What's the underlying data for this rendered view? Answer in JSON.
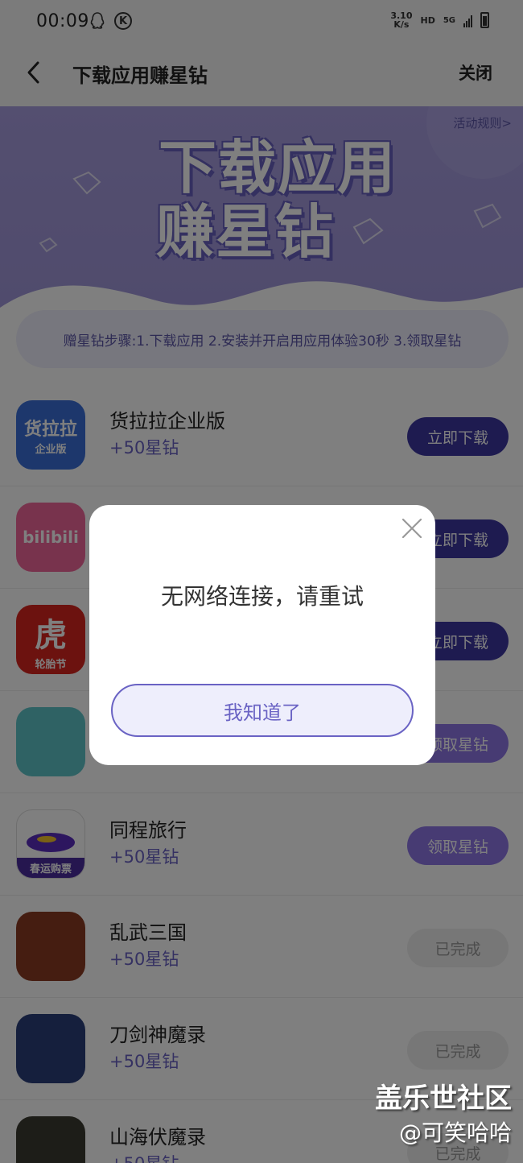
{
  "status_bar": {
    "time": "00:09",
    "net_speed_top": "3.10",
    "net_speed_bottom": "K/s",
    "hd": "HD",
    "network": "5G",
    "icons": [
      "qq-icon",
      "k-icon",
      "signal-icon",
      "battery-icon"
    ]
  },
  "nav": {
    "title": "下载应用赚星钻",
    "close": "关闭"
  },
  "banner": {
    "rules_link": "活动规则>",
    "title_line1": "下载应用",
    "title_line2": "赚星钻",
    "steps": "赠星钻步骤:1.下载应用 2.安装并开启用应用体验30秒 3.领取星钻"
  },
  "apps": [
    {
      "name": "货拉拉企业版",
      "reward": "+50星钻",
      "button": "立即下载",
      "state": "download",
      "icon_text": "货拉拉",
      "icon_sub": "企业版",
      "icon_color": "#3a6fd8"
    },
    {
      "name": "",
      "reward": "",
      "button": "立即下载",
      "state": "download",
      "icon_text": "bilibili",
      "icon_color": "#f0679a"
    },
    {
      "name": "",
      "reward": "",
      "button": "立即下载",
      "state": "download",
      "icon_text": "虎",
      "icon_sub": "轮胎节",
      "icon_color": "#d8251f"
    },
    {
      "name": "",
      "reward": "",
      "button": "领取星钻",
      "state": "claim",
      "icon_text": "",
      "icon_color": "#5ec5c9"
    },
    {
      "name": "同程旅行",
      "reward": "+50星钻",
      "button": "领取星钻",
      "state": "claim",
      "icon_text": "",
      "icon_sub": "春运购票",
      "icon_color": "#ffffff"
    },
    {
      "name": "乱武三国",
      "reward": "+50星钻",
      "button": "已完成",
      "state": "done",
      "icon_text": "",
      "icon_color": "#8a3a22"
    },
    {
      "name": "刀剑神魔录",
      "reward": "+50星钻",
      "button": "已完成",
      "state": "done",
      "icon_text": "",
      "icon_color": "#2b3f7a"
    },
    {
      "name": "山海伏魔录",
      "reward": "+50星钻",
      "button": "已完成",
      "state": "done",
      "icon_text": "",
      "icon_color": "#3a3a30"
    }
  ],
  "dialog": {
    "message": "无网络连接，请重试",
    "ok_button": "我知道了"
  },
  "watermark": {
    "line1": "盖乐世社区",
    "line2": "@可笑哈哈"
  },
  "colors": {
    "accent": "#6a63c4",
    "download_btn": "#3d36a0",
    "claim_btn": "#8e76e6",
    "banner": "#a89ee0"
  }
}
